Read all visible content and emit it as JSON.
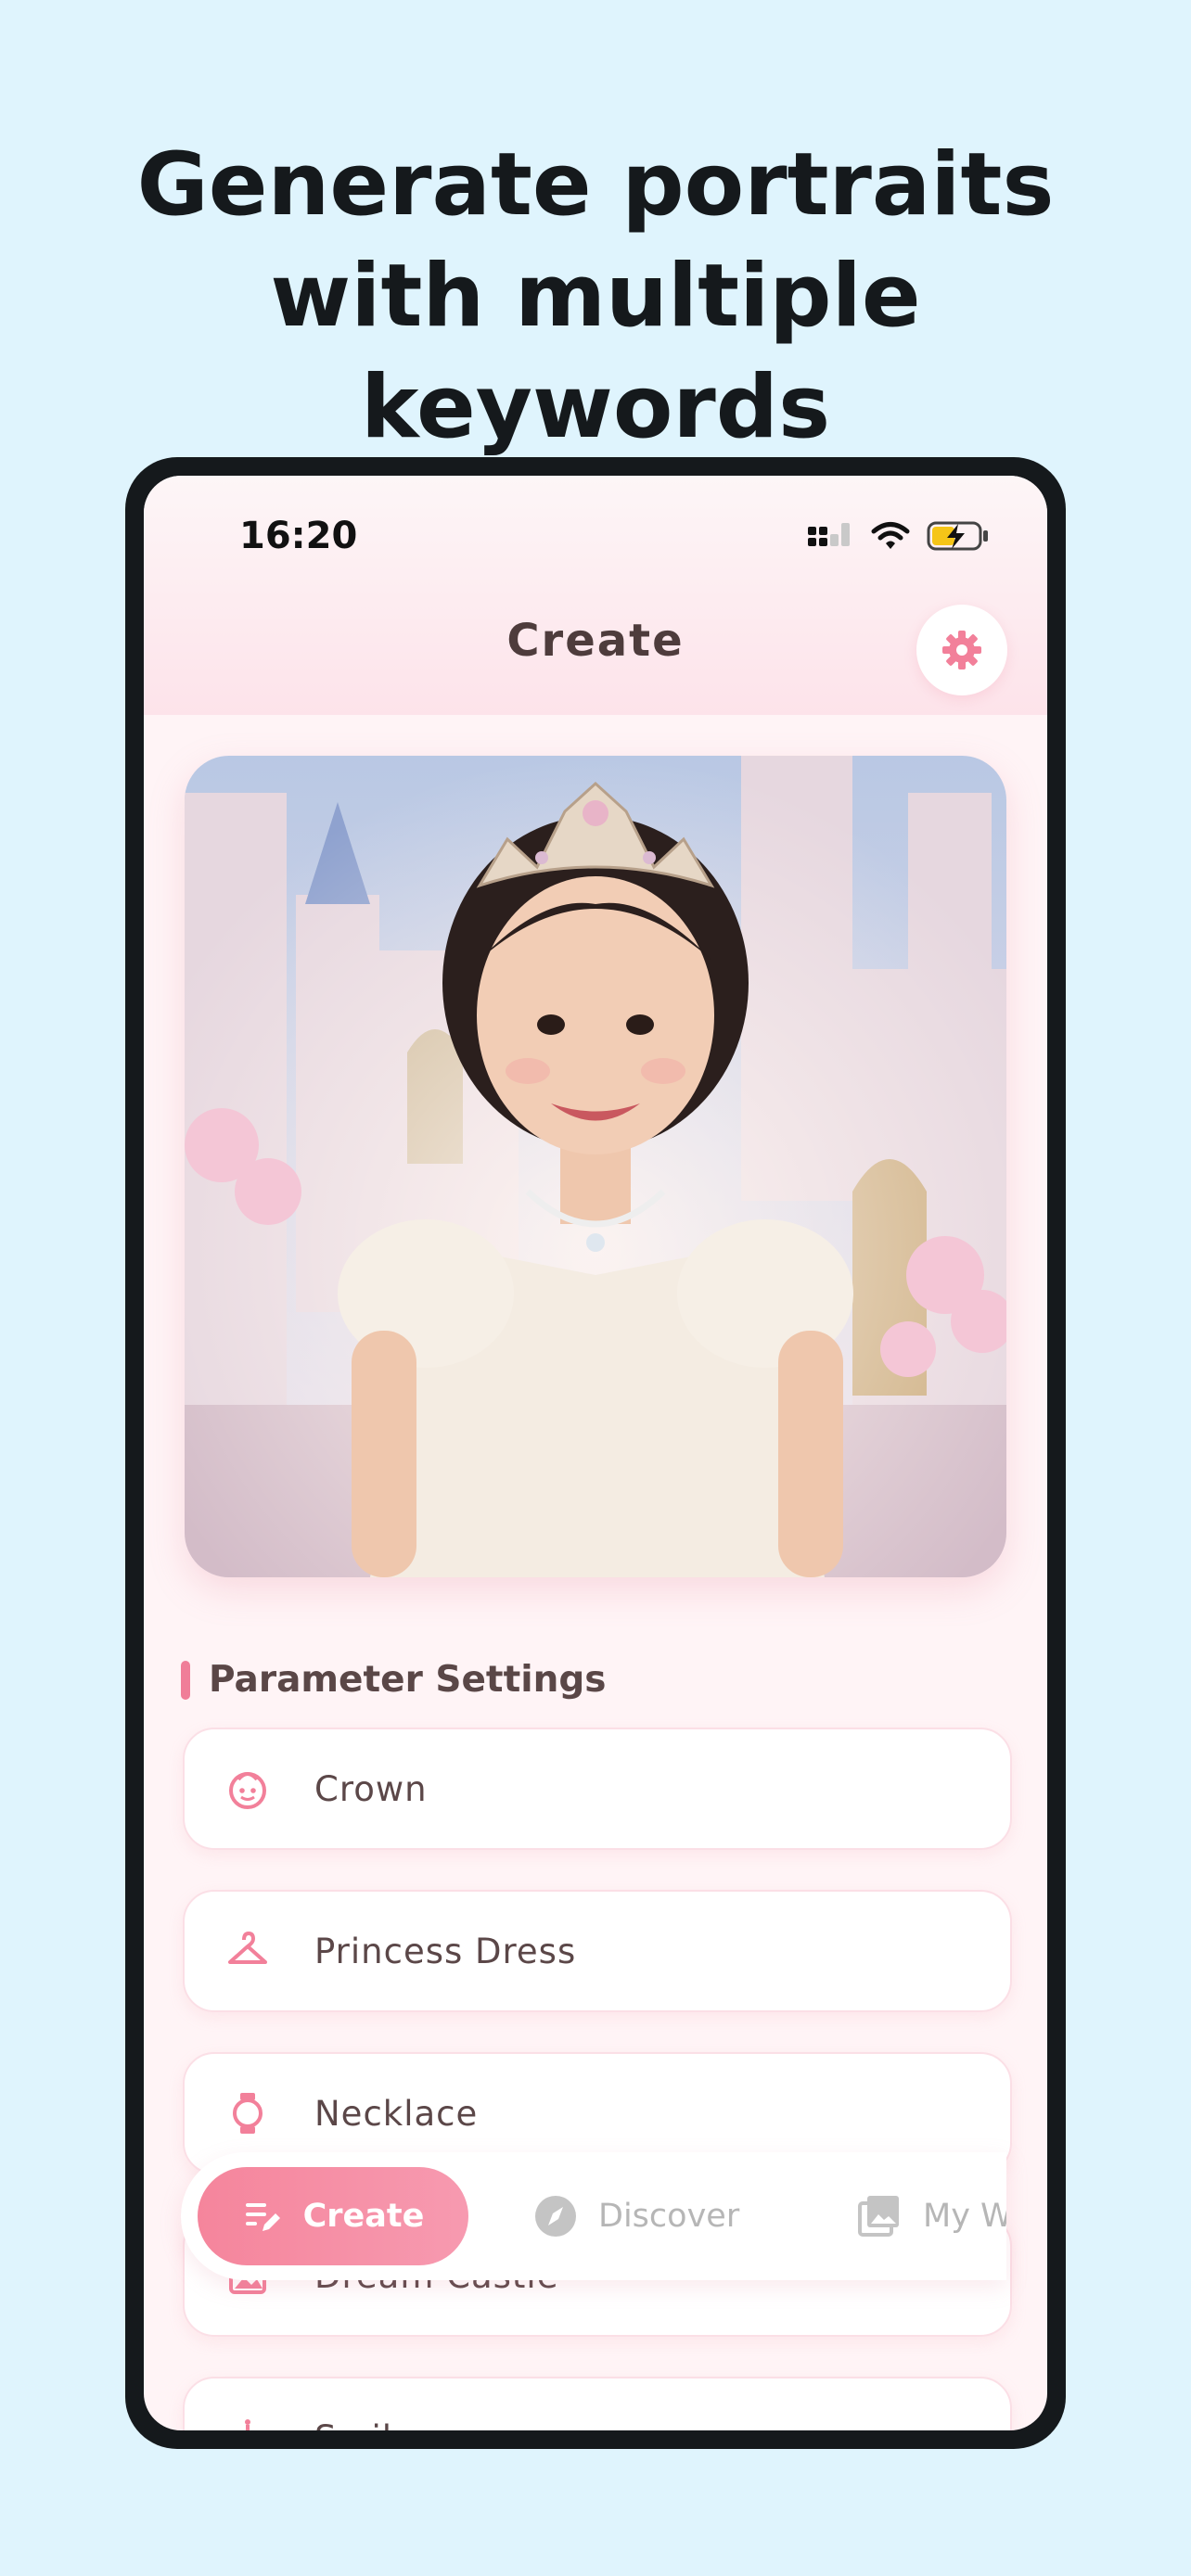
{
  "headline": {
    "line1": "Generate portraits",
    "line2": "with multiple",
    "line3": "keywords"
  },
  "status_bar": {
    "time": "16:20",
    "icons": [
      "signal-icon",
      "wifi-icon",
      "battery-charging-icon"
    ]
  },
  "header": {
    "title": "Create",
    "settings_icon": "gear-icon"
  },
  "hero_image": {
    "description_icon": "portrait-image"
  },
  "parameters": {
    "section_title": "Parameter Settings",
    "items": [
      {
        "label": "Crown",
        "icon": "face-icon"
      },
      {
        "label": "Princess Dress",
        "icon": "hanger-icon"
      },
      {
        "label": "Necklace",
        "icon": "watch-icon"
      },
      {
        "label": "Dream Castle",
        "icon": "picture-icon"
      },
      {
        "label": "Smile",
        "icon": "cake-icon"
      }
    ]
  },
  "tab_bar": {
    "tabs": [
      {
        "label": "Create",
        "icon": "edit-icon",
        "active": true
      },
      {
        "label": "Discover",
        "icon": "compass-icon",
        "active": false
      },
      {
        "label": "My Works",
        "icon": "gallery-icon",
        "active": false
      }
    ]
  },
  "colors": {
    "background": "#dff4fd",
    "accent": "#f07e98",
    "frame": "#15191c",
    "text_dark": "#4e3c3c"
  }
}
